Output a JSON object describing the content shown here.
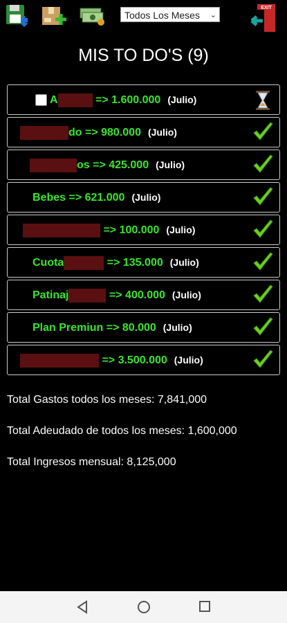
{
  "dropdown": {
    "selected": "Todos Los Meses"
  },
  "title": "MIS TO DO'S (9)",
  "items": [
    {
      "prefix": "A",
      "suffix": " => 1.600.000",
      "month": "(Julio)",
      "status": "pending"
    },
    {
      "prefix": "",
      "suffix": "do => 980.000",
      "month": "(Julio)",
      "status": "done"
    },
    {
      "prefix": "",
      "suffix": "os => 425.000",
      "month": "(Julio)",
      "status": "done"
    },
    {
      "prefix": "Bebes => 621.000",
      "suffix": "",
      "month": "(Julio)",
      "status": "done"
    },
    {
      "prefix": "",
      "suffix": " => 100.000",
      "month": "(Julio)",
      "status": "done"
    },
    {
      "prefix": "Cuota",
      "suffix": " => 135.000",
      "month": "(Julio)",
      "status": "done"
    },
    {
      "prefix": "Patinaj",
      "suffix": " => 400.000",
      "month": "(Julio)",
      "status": "done"
    },
    {
      "prefix": "Plan Premiun => 80.000",
      "suffix": "",
      "month": "(Julio)",
      "status": "done"
    },
    {
      "prefix": "",
      "suffix": " => 3.500.000",
      "month": "(Julio)",
      "status": "done"
    }
  ],
  "totals": {
    "gastos": "Total Gastos todos los meses: 7,841,000",
    "adeudado": "Total Adeudado de todos los meses: 1,600,000",
    "ingresos": "Total Ingresos mensual: 8,125,000"
  },
  "colors": {
    "accent_green": "#39e52c",
    "background": "#000000"
  }
}
